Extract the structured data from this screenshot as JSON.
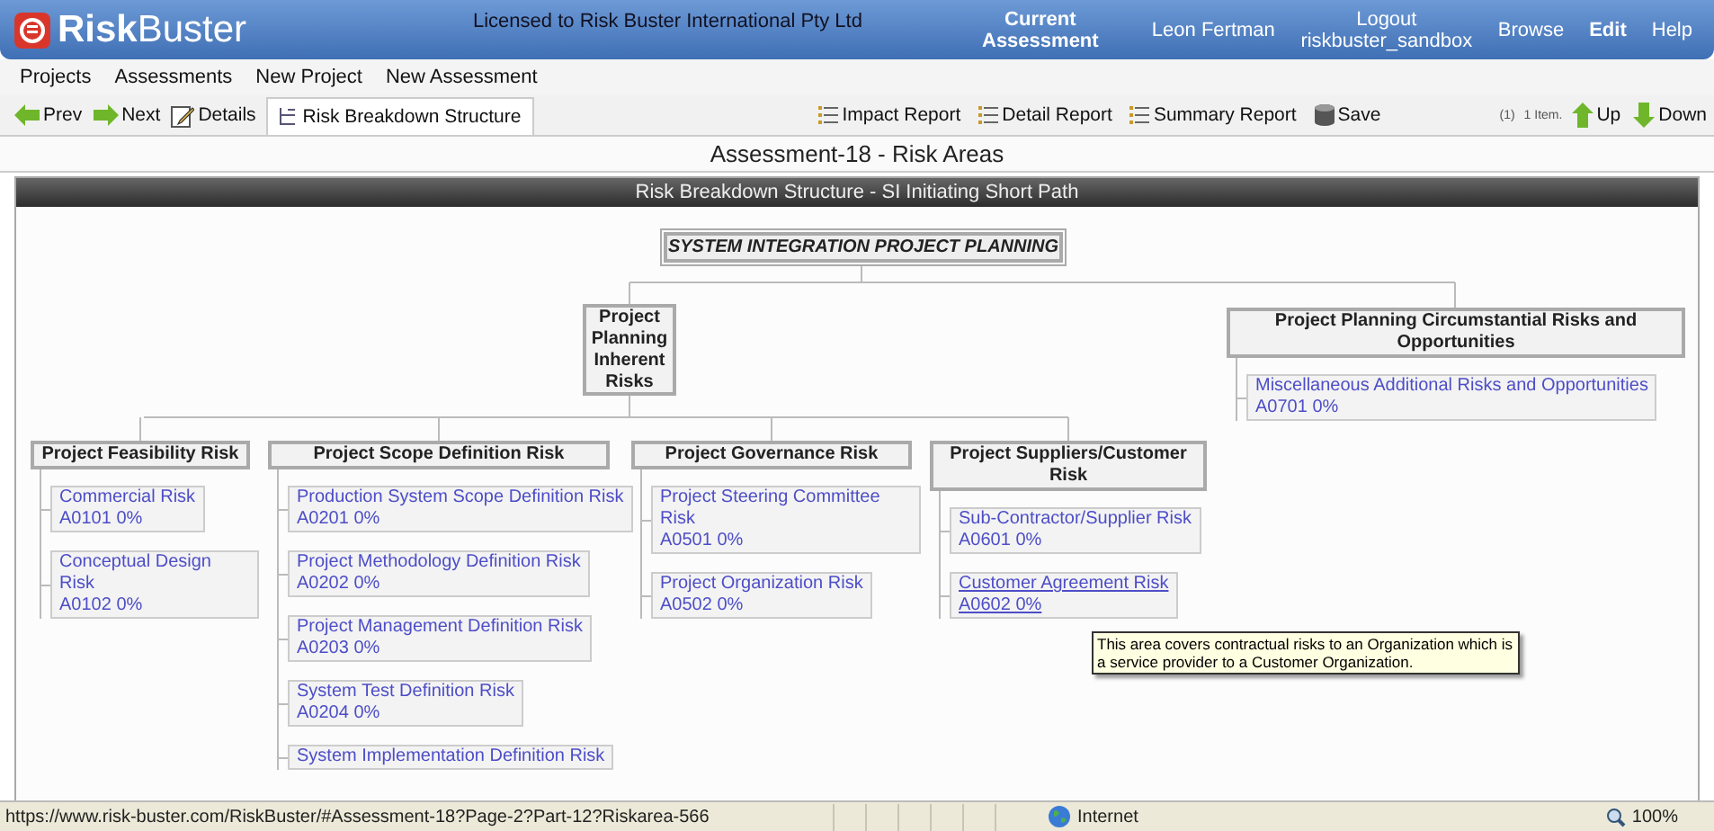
{
  "header": {
    "logo": "**Risk**Buster",
    "license": "Licensed to Risk Buster International Pty Ltd",
    "links": [
      {
        "label": "Current Assessment",
        "bold": true
      },
      {
        "label": "Leon Fertman",
        "bold": false
      },
      {
        "label": "Logout riskbuster_sandbox",
        "bold": false
      },
      {
        "label": "Browse",
        "bold": false
      },
      {
        "label": "Edit",
        "bold": true
      },
      {
        "label": "Help",
        "bold": false
      }
    ]
  },
  "menu": [
    "Projects",
    "Assessments",
    "New Project",
    "New Assessment"
  ],
  "toolbar": {
    "nav": [
      {
        "kind": "prev",
        "label": "Prev"
      },
      {
        "kind": "next",
        "label": "Next"
      },
      {
        "kind": "details",
        "label": "Details"
      }
    ],
    "tabs": [
      {
        "label": "Risk Breakdown Structure",
        "selected": true
      }
    ],
    "actions": [
      {
        "kind": "report",
        "label": "Impact Report"
      },
      {
        "kind": "report",
        "label": "Detail Report"
      },
      {
        "kind": "report",
        "label": "Summary Report"
      },
      {
        "kind": "save",
        "label": "Save"
      }
    ],
    "count": "(1)",
    "items_label": "1 Item.",
    "moves": [
      {
        "kind": "up",
        "label": "Up"
      },
      {
        "kind": "down",
        "label": "Down"
      }
    ]
  },
  "page_title": "Assessment-18 - Risk Areas",
  "panel_title": "Risk Breakdown Structure - SI Initiating Short Path",
  "diagram": {
    "root": "SYSTEM INTEGRATION PROJECT PLANNING",
    "branches": [
      {
        "label": "Project Planning Inherent Risks",
        "groups": [
          {
            "label": "Project Feasibility Risk",
            "items": [
              {
                "name": "Commercial Risk",
                "code": "A0101 0%",
                "hovered": false
              },
              {
                "name": "Conceptual Design Risk",
                "code": "A0102 0%",
                "hovered": false
              }
            ]
          },
          {
            "label": "Project Scope Definition Risk",
            "items": [
              {
                "name": "Production System Scope Definition Risk",
                "code": "A0201 0%",
                "hovered": false
              },
              {
                "name": "Project Methodology Definition Risk",
                "code": "A0202 0%",
                "hovered": false
              },
              {
                "name": "Project Management Definition Risk",
                "code": "A0203 0%",
                "hovered": false
              },
              {
                "name": "System Test Definition Risk",
                "code": "A0204 0%",
                "hovered": false
              },
              {
                "name": "System Implementation Definition Risk",
                "hovered": false
              }
            ]
          },
          {
            "label": "Project Governance Risk",
            "items": [
              {
                "name": "Project Steering Committee Risk",
                "code": "A0501 0%",
                "hovered": false
              },
              {
                "name": "Project Organization Risk",
                "code": "A0502 0%",
                "hovered": false
              }
            ]
          },
          {
            "label": "Project Suppliers/Customer Risk",
            "items": [
              {
                "name": "Sub-Contractor/Supplier Risk",
                "code": "A0601 0%",
                "hovered": false
              },
              {
                "name": "Customer Agreement Risk",
                "code": "A0602 0%",
                "hovered": true
              }
            ]
          }
        ]
      },
      {
        "label": "Project Planning Circumstantial Risks and Opportunities",
        "groups": [
          {
            "items": [
              {
                "name": "Miscellaneous Additional Risks and Opportunities",
                "code": "A0701 0%",
                "hovered": false
              }
            ]
          }
        ]
      }
    ]
  },
  "tooltip": "This area covers contractual risks to an Organization which is a service provider to a Customer Organization.",
  "status_bar": {
    "url": "https://www.risk-buster.com/RiskBuster/#Assessment-18?Page-2?Part-12?Riskarea-566",
    "zone": "Internet",
    "zoom": "100%"
  }
}
